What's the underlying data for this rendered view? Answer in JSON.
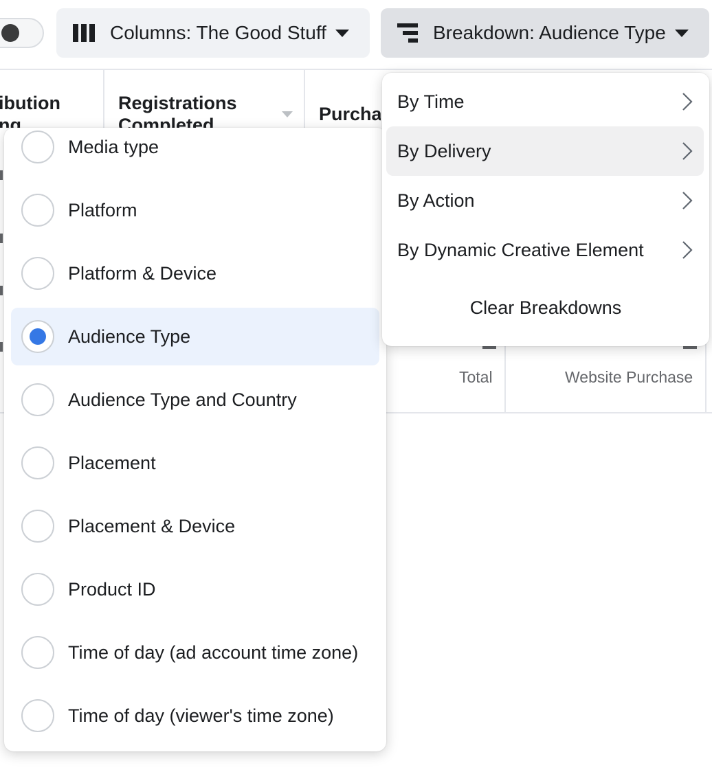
{
  "toolbar": {
    "columns_label": "Columns: The Good Stuff",
    "breakdown_label": "Breakdown: Audience Type"
  },
  "table": {
    "headers": [
      {
        "text": "ibution"
      },
      {
        "text": "ng"
      },
      {
        "text": "Registrations"
      },
      {
        "text": "Completed"
      },
      {
        "text": "Purcha"
      }
    ],
    "footer": {
      "total_label": "Total",
      "website_purchase_label": "Website Purchase"
    }
  },
  "breakdown_options": [
    {
      "label": "Media type",
      "selected": false
    },
    {
      "label": "Platform",
      "selected": false
    },
    {
      "label": "Platform & Device",
      "selected": false
    },
    {
      "label": "Audience Type",
      "selected": true
    },
    {
      "label": "Audience Type and Country",
      "selected": false
    },
    {
      "label": "Placement",
      "selected": false
    },
    {
      "label": "Placement & Device",
      "selected": false
    },
    {
      "label": "Product ID",
      "selected": false
    },
    {
      "label": "Time of day (ad account time zone)",
      "selected": false
    },
    {
      "label": "Time of day (viewer's time zone)",
      "selected": false
    }
  ],
  "breakdown_categories": [
    {
      "label": "By Time",
      "active": false
    },
    {
      "label": "By Delivery",
      "active": true
    },
    {
      "label": "By Action",
      "active": false
    },
    {
      "label": "By Dynamic Creative Element",
      "active": false
    }
  ],
  "clear_label": "Clear Breakdowns",
  "colors": {
    "accent": "#3578e5",
    "selected_bg": "#ebf2fd",
    "hover_bg": "#f0f0f1"
  }
}
